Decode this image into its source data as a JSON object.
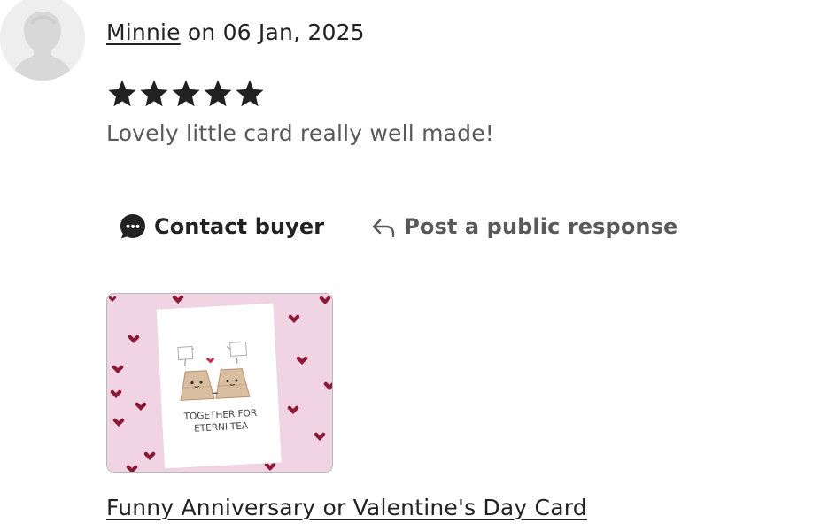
{
  "review": {
    "reviewer_name": "Minnie",
    "date_text": " on 06 Jan, 2025",
    "rating": 5,
    "rating_max": 5,
    "text": "Lovely little card really well made!"
  },
  "actions": {
    "contact_label": "Contact buyer",
    "respond_label": "Post a public response"
  },
  "listing": {
    "title": "Funny Anniversary or Valentine's Day Card",
    "image_text": [
      "TOGETHER FOR",
      "ETERNI-TEA"
    ]
  },
  "colors": {
    "text_primary": "#222222",
    "text_secondary": "#595959",
    "avatar_bg": "#eeeeee",
    "thumb_bg": "#f0d4e3",
    "heart": "#8c1a36"
  },
  "icons": {
    "avatar": "default-user-avatar",
    "star": "star-filled-icon",
    "contact": "chat-bubble-icon",
    "respond": "reply-arrow-icon"
  }
}
